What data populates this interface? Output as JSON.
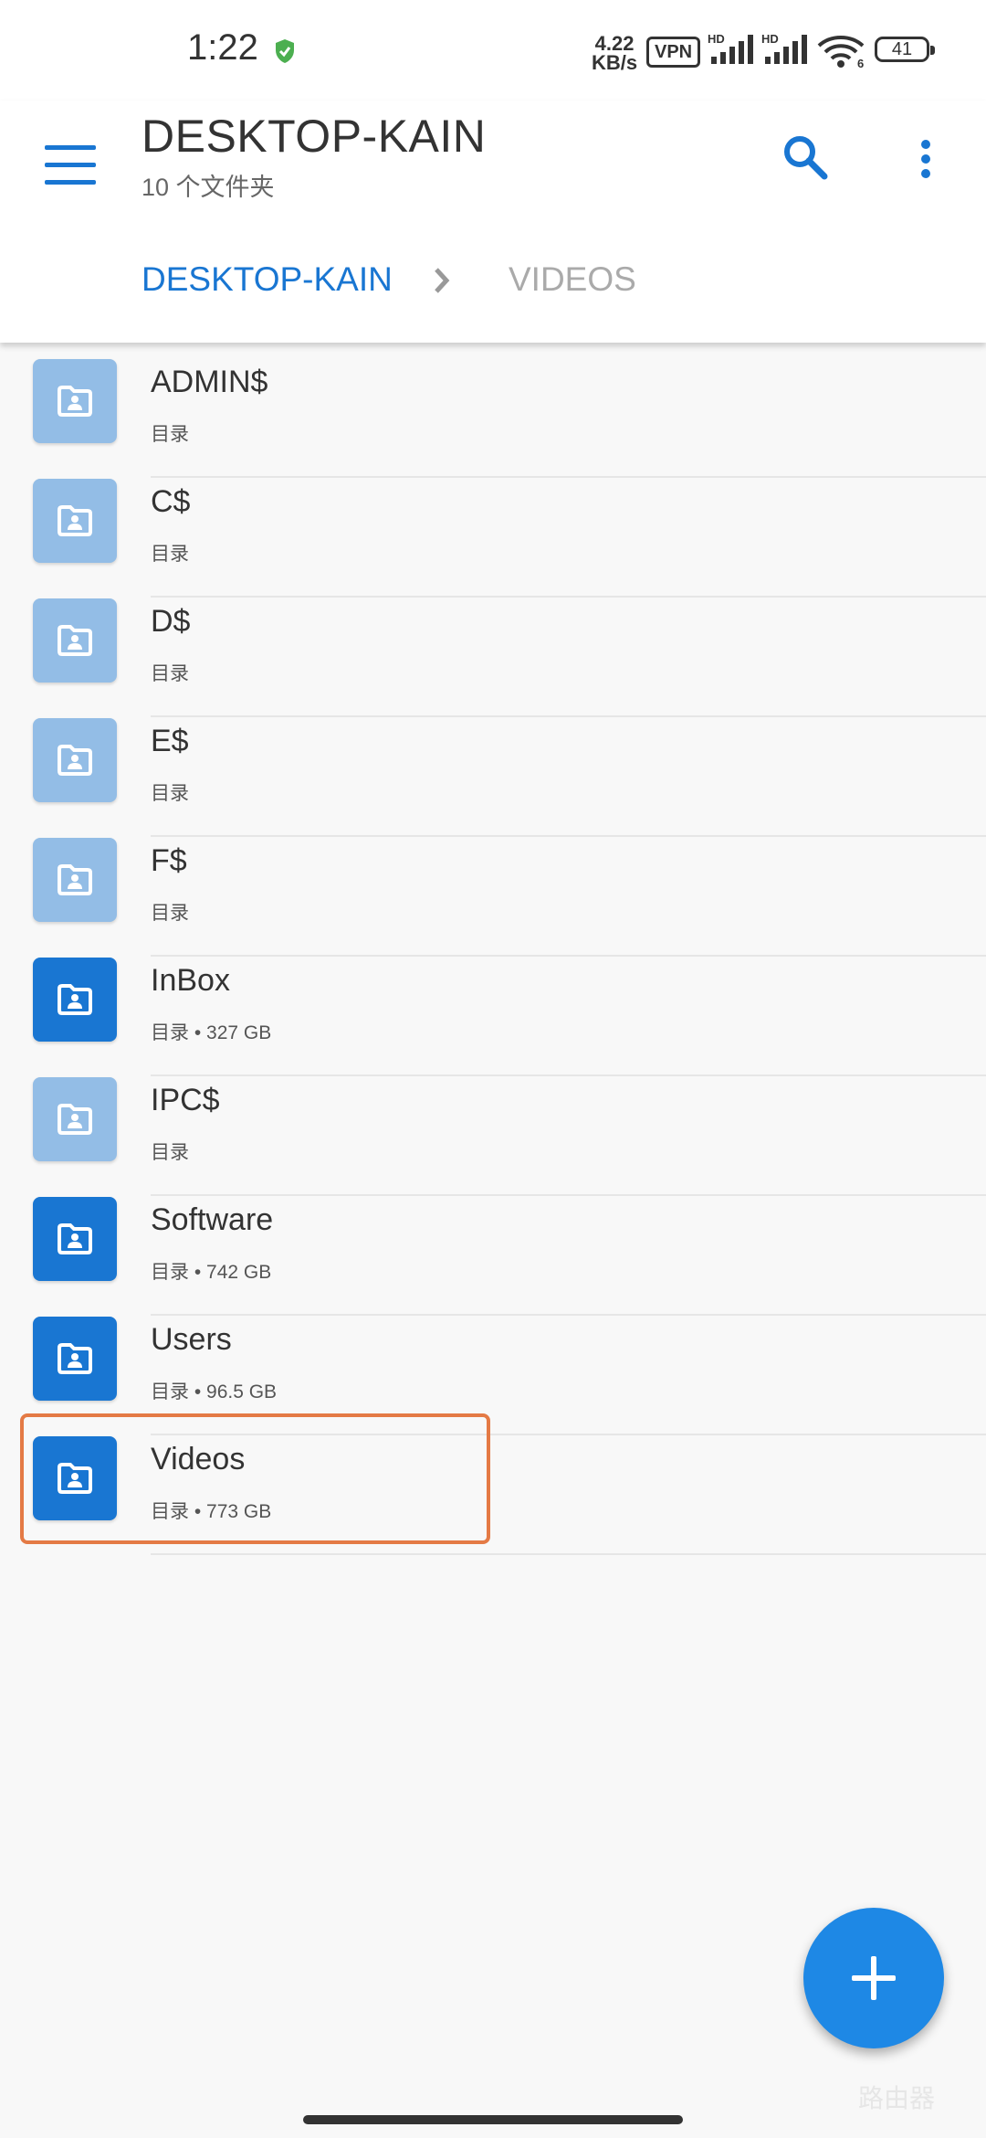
{
  "status_bar": {
    "time": "1:22",
    "net_speed_value": "4.22",
    "net_speed_unit": "KB/s",
    "vpn": "VPN",
    "signal1_label": "HD",
    "signal2_label": "HD",
    "wifi_label": "6",
    "battery": "41"
  },
  "header": {
    "title": "DESKTOP-KAIN",
    "subtitle": "10 个文件夹"
  },
  "breadcrumb": {
    "items": [
      "DESKTOP-KAIN",
      "VIDEOS"
    ]
  },
  "colors": {
    "accent": "#1976d2",
    "folder_available": "#1976d2",
    "folder_unavailable": "#93bde6",
    "highlight": "#e47a45"
  },
  "folders": [
    {
      "name": "ADMIN$",
      "detail": "目录",
      "icon": "folder-shared-icon",
      "available": false
    },
    {
      "name": "C$",
      "detail": "目录",
      "icon": "folder-shared-icon",
      "available": false
    },
    {
      "name": "D$",
      "detail": "目录",
      "icon": "folder-shared-icon",
      "available": false
    },
    {
      "name": "E$",
      "detail": "目录",
      "icon": "folder-shared-icon",
      "available": false
    },
    {
      "name": "F$",
      "detail": "目录",
      "icon": "folder-shared-icon",
      "available": false
    },
    {
      "name": "InBox",
      "detail": "目录 • 327 GB",
      "icon": "folder-shared-icon",
      "available": true
    },
    {
      "name": "IPC$",
      "detail": "目录",
      "icon": "folder-shared-icon",
      "available": false
    },
    {
      "name": "Software",
      "detail": "目录 • 742 GB",
      "icon": "folder-shared-icon",
      "available": true
    },
    {
      "name": "Users",
      "detail": "目录 • 96.5 GB",
      "icon": "folder-shared-icon",
      "available": true
    },
    {
      "name": "Videos",
      "detail": "目录 • 773 GB",
      "icon": "folder-shared-icon",
      "available": true
    }
  ],
  "fab": {
    "icon": "plus-icon"
  },
  "watermark": "路由器"
}
